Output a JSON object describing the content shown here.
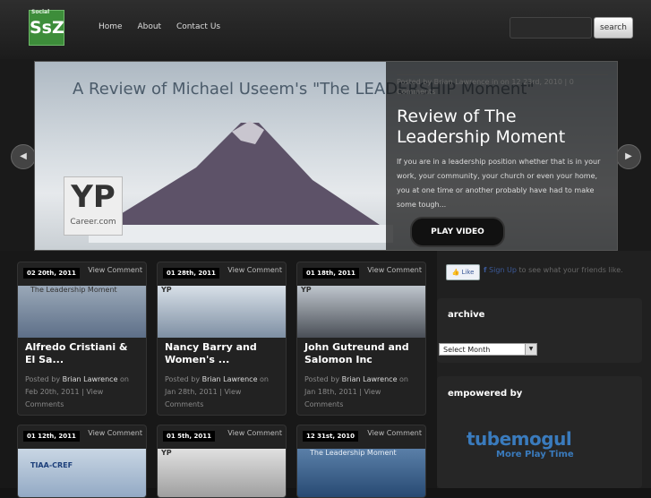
{
  "logo": {
    "small": "Social",
    "mark": "SsZ"
  },
  "nav": [
    "Home",
    "About",
    "Contact Us"
  ],
  "search": {
    "button": "search",
    "placeholder": ""
  },
  "slider": {
    "image_caption": "A Review of Michael Useem's \"The LEADERSHIP Moment\"",
    "image_badge": "YP",
    "image_badge_sub": "Career.com",
    "meta": "Posted by Brian Lawrence in on 12 23rd, 2010 | 0 Comments",
    "title": "Review of The Leadership Moment",
    "excerpt": "If you are in a leadership position whether that is in your work, your community, your church or even your home, you at one time or another probably have had to make some tough...",
    "play_button": "PLAY VIDEO",
    "prev": "◀",
    "next": "▶"
  },
  "cards": [
    {
      "date": "02 20th, 2011",
      "view": "View Comment",
      "thumb_text": "The Leadership Moment",
      "title": "Alfredo Cristiani & El Sa...",
      "author": "Brian Lawrence",
      "meta_tail": "Feb 20th, 2011 | View Comments"
    },
    {
      "date": "01 28th, 2011",
      "view": "View Comment",
      "thumb_text": "YP",
      "title": "Nancy Barry and Women's ...",
      "author": "Brian Lawrence",
      "meta_tail": "Jan 28th, 2011 | View Comments"
    },
    {
      "date": "01 18th, 2011",
      "view": "View Comment",
      "thumb_text": "YP",
      "title": "John Gutreund and Salomon Inc",
      "author": "Brian Lawrence",
      "meta_tail": "Jan 18th, 2011 | View Comments"
    },
    {
      "date": "01 12th, 2011",
      "view": "View Comment",
      "thumb_text": "TIAA-CREF"
    },
    {
      "date": "01 5th, 2011",
      "view": "View Comment",
      "thumb_text": "YP"
    },
    {
      "date": "12 31st, 2010",
      "view": "View Comment",
      "thumb_text": "The Leadership Moment"
    }
  ],
  "card_author_prefix": "Posted by",
  "card_author_suffix": "on",
  "sidebar": {
    "fb_like": "Like",
    "fb_signup": "Sign Up",
    "fb_text": "to see what your friends like.",
    "archive_title": "archive",
    "archive_select": "Select Month",
    "empowered_title": "empowered by",
    "tubemogul": "tubemogul",
    "tubemogul_tag": "More Play Time"
  },
  "colors": {
    "accent": "#3d8d3a",
    "brand_blue": "#3a7bbd",
    "background": "#141414"
  }
}
